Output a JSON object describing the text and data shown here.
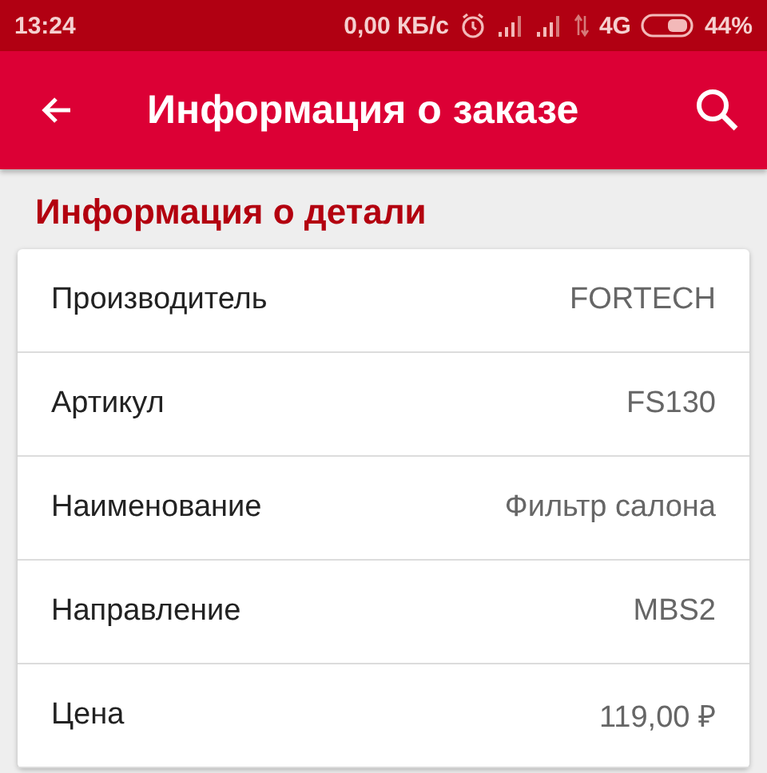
{
  "status_bar": {
    "time": "13:24",
    "speed": "0,00 КБ/с",
    "network": "4G",
    "battery": "44%"
  },
  "app_bar": {
    "title": "Информация о заказе"
  },
  "section": {
    "title": "Информация о детали"
  },
  "rows": [
    {
      "label": "Производитель",
      "value": "FORTECH"
    },
    {
      "label": "Артикул",
      "value": "FS130"
    },
    {
      "label": "Наименование",
      "value": "Фильтр салона"
    },
    {
      "label": "Направление",
      "value": "MBS2"
    },
    {
      "label": "Цена",
      "value": "119,00 ₽"
    }
  ]
}
